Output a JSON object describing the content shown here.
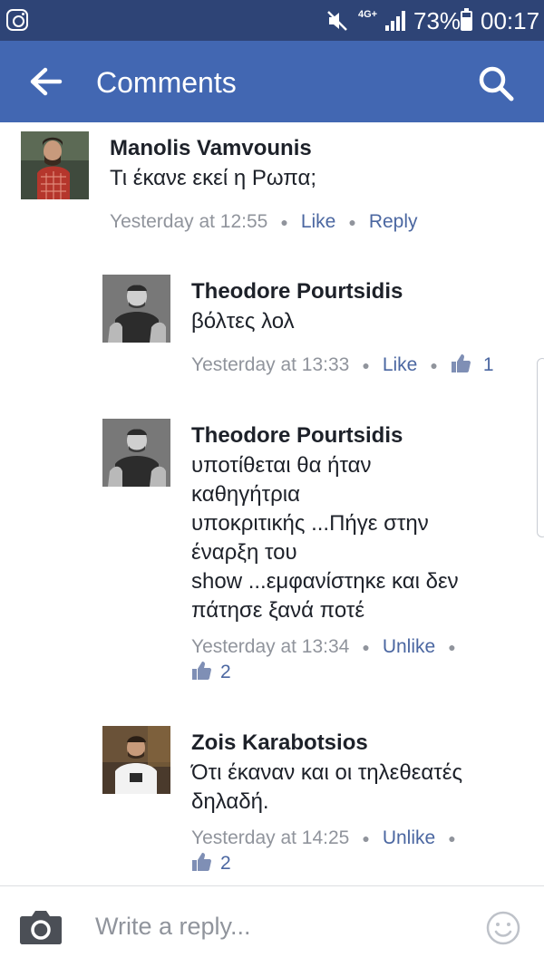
{
  "status_bar": {
    "network": "4G+",
    "battery_percent": "73%",
    "battery_level": 0.73,
    "time": "00:17",
    "icons": [
      "instagram-icon",
      "mute-icon",
      "signal-icon",
      "battery-icon"
    ]
  },
  "app_bar": {
    "title": "Comments",
    "back_icon": "arrow-left-icon",
    "search_icon": "search-icon"
  },
  "colors": {
    "status_bar_bg": "#2e4476",
    "app_bar_bg": "#4267b2",
    "link": "#4b67a1",
    "meta_gray": "#90949c",
    "text": "#1d2129"
  },
  "comments": [
    {
      "author": "Manolis Vamvounis",
      "lines": [
        "Τι έκανε εκεί η Ρωπα;"
      ],
      "time": "Yesterday at 12:55",
      "like_label": "Like",
      "reply_label": "Reply"
    },
    {
      "author": "Theodore Pourtsidis",
      "lines": [
        "βόλτες λολ"
      ],
      "time": "Yesterday at 13:33",
      "like_label": "Like",
      "reactions": "1"
    },
    {
      "author": "Theodore Pourtsidis",
      "lines": [
        "υποτίθεται θα ήταν",
        "καθηγήτρια",
        "υποκριτικής ...Πήγε στην",
        "έναρξη του",
        "show ...εμφανίστηκε και δεν",
        "πάτησε ξανά ποτέ"
      ],
      "time": "Yesterday at 13:34",
      "like_label": "Unlike",
      "reactions": "2"
    },
    {
      "author": "Zois Karabotsios",
      "lines": [
        "Ότι έκαναν και οι τηλεθεατές",
        "δηλαδή."
      ],
      "time": "Yesterday at 14:25",
      "like_label": "Unlike",
      "reactions": "2"
    }
  ],
  "reply_bar": {
    "placeholder": "Write a reply...",
    "camera_icon": "camera-icon",
    "emoji_icon": "smiley-icon"
  }
}
